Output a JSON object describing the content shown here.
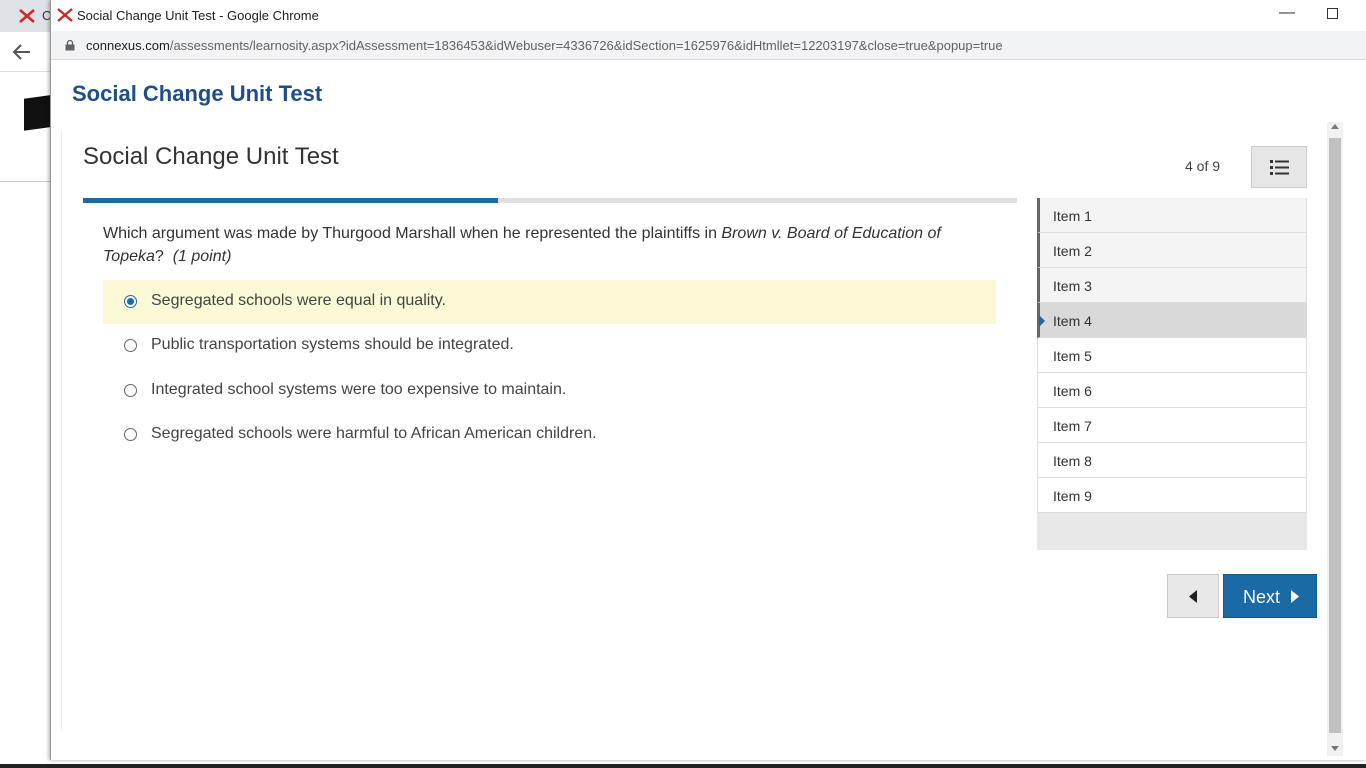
{
  "background": {
    "tab_label": "C"
  },
  "window": {
    "title": "Social Change Unit Test - Google Chrome",
    "url_host": "connexus.com",
    "url_path": "/assessments/learnosity.aspx?idAssessment=1836453&idWebuser=4336726&idSection=1625976&idHtmllet=12203197&close=true&popup=true"
  },
  "page": {
    "header_title": "Social Change Unit Test",
    "test_title": "Social Change Unit Test",
    "progress_fraction": 0.444
  },
  "question": {
    "text_before": "Which argument was made by Thurgood Marshall when he represented the plaintiffs in ",
    "case_name": "Brown v. Board of Education of Topeka",
    "text_after": "?",
    "points": "(1 point)",
    "options": [
      {
        "label": "Segregated schools were equal in quality.",
        "selected": true
      },
      {
        "label": "Public transportation systems should be integrated.",
        "selected": false
      },
      {
        "label": "Integrated school systems were too expensive to maintain.",
        "selected": false
      },
      {
        "label": "Segregated schools were harmful to African American children.",
        "selected": false
      }
    ]
  },
  "navigation": {
    "counter": "4 of 9",
    "items": [
      {
        "label": "Item 1",
        "state": "visited"
      },
      {
        "label": "Item 2",
        "state": "visited"
      },
      {
        "label": "Item 3",
        "state": "visited"
      },
      {
        "label": "Item 4",
        "state": "current"
      },
      {
        "label": "Item 5",
        "state": "unvisited"
      },
      {
        "label": "Item 6",
        "state": "unvisited"
      },
      {
        "label": "Item 7",
        "state": "unvisited"
      },
      {
        "label": "Item 8",
        "state": "unvisited"
      },
      {
        "label": "Item 9",
        "state": "unvisited"
      }
    ],
    "next_label": "Next"
  },
  "colors": {
    "brand_blue": "#1a6aa5",
    "title_blue": "#1d4e89",
    "selected_highlight": "#fbf8d6"
  },
  "icons": {
    "window_icon": "connexus-x-icon",
    "menu": "list-icon",
    "prev": "caret-left-icon",
    "next": "caret-right-icon",
    "lock": "lock-icon"
  }
}
